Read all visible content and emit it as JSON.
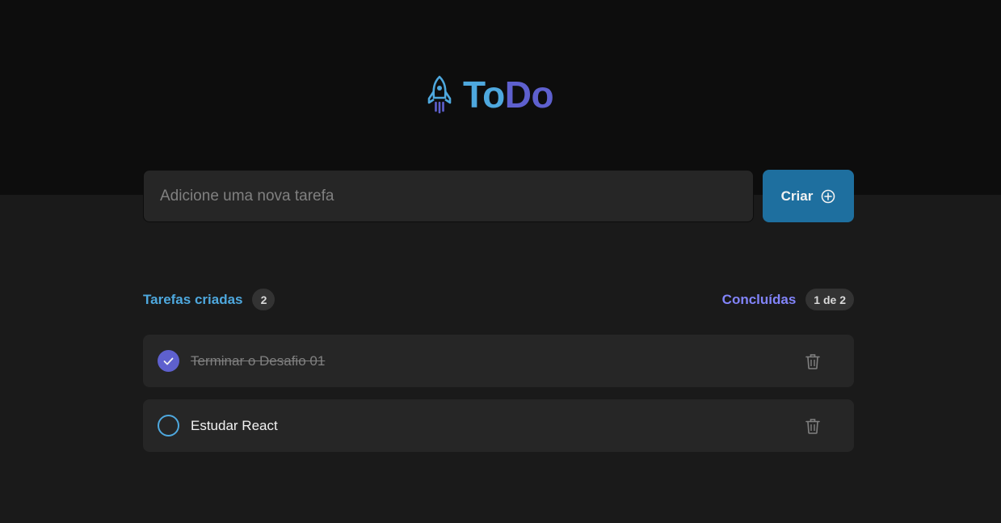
{
  "app": {
    "logo_to": "To",
    "logo_do": "Do"
  },
  "new_task": {
    "placeholder": "Adicione uma nova tarefa",
    "value": "",
    "button_label": "Criar"
  },
  "info": {
    "created_label": "Tarefas criadas",
    "created_count": "2",
    "done_label": "Concluídas",
    "done_count": "1 de 2"
  },
  "tasks": [
    {
      "text": "Terminar o Desafio 01",
      "completed": true
    },
    {
      "text": "Estudar React",
      "completed": false
    }
  ],
  "icons": {
    "logo": "rocket-icon",
    "create": "plus-circle-icon",
    "check": "check-icon",
    "delete": "trash-icon"
  },
  "colors": {
    "blue": "#4ea8de",
    "purple": "#5e60ce",
    "purple_light": "#8284fa",
    "blue_dark": "#1e6f9f",
    "gray_700": "#0d0d0d",
    "gray_600": "#1a1a1a",
    "gray_500": "#262626",
    "gray_400": "#333333",
    "gray_300": "#808080",
    "gray_100": "#f2f2f2"
  }
}
